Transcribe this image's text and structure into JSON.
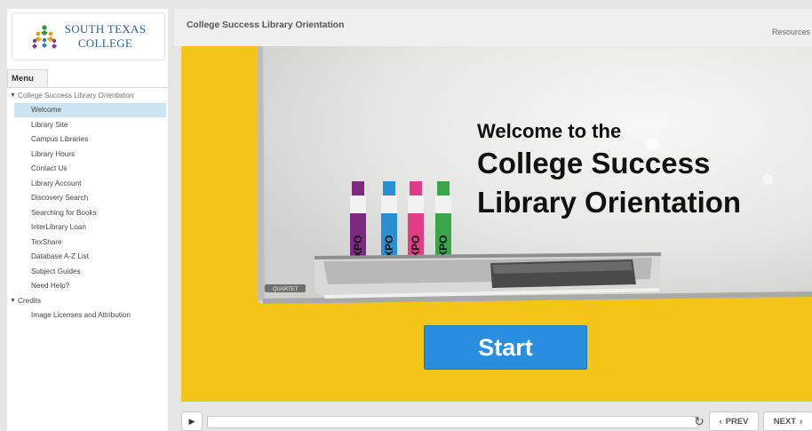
{
  "logo": {
    "line1": "South Texas",
    "line2": "College"
  },
  "sidebar": {
    "menu_tab": "Menu",
    "sections": [
      {
        "label": "College Success Library Orientation",
        "items": [
          {
            "label": "Welcome",
            "active": true
          },
          {
            "label": "Library Site"
          },
          {
            "label": "Campus Libraries"
          },
          {
            "label": "Library Hours"
          },
          {
            "label": "Contact Us"
          },
          {
            "label": "Library Account"
          },
          {
            "label": "Discovery Search"
          },
          {
            "label": "Searching for Books"
          },
          {
            "label": "InterLibrary Loan"
          },
          {
            "label": "TexShare"
          },
          {
            "label": "Database A-Z List"
          },
          {
            "label": "Subject Guides"
          },
          {
            "label": "Need Help?"
          }
        ]
      },
      {
        "label": "Credits",
        "items": [
          {
            "label": "Image Licenses and Attribution"
          }
        ]
      }
    ]
  },
  "header": {
    "title": "College Success Library Orientation",
    "resources": "Resources"
  },
  "slide": {
    "welcome_line1": "Welcome to the",
    "welcome_line2": "College Success",
    "welcome_line3": "Library Orientation",
    "marker_brand": "EXPO",
    "tray_brand": "QUARTET",
    "start_label": "Start"
  },
  "player": {
    "progress": 0,
    "prev_label": "PREV",
    "next_label": "NEXT"
  },
  "colors": {
    "accent": "#2a8ee0",
    "slide_bg": "#f4c516",
    "active_item": "#cce4f1",
    "logo_text": "#2c5f92"
  }
}
